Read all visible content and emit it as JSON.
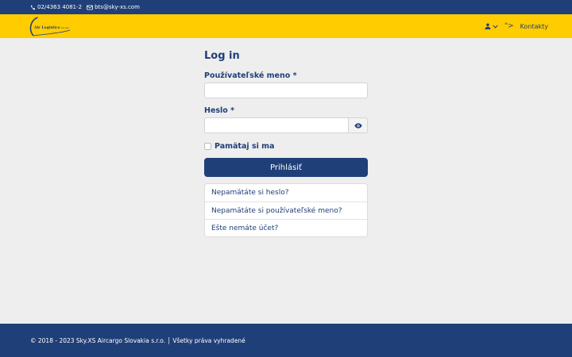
{
  "topbar": {
    "phone": "02/4363 4081-2",
    "email": "bts@sky-xs.com"
  },
  "logo": {
    "name": "Air Logistics",
    "suffix": "Group"
  },
  "nav": {
    "quote": "\">",
    "contacts": "Kontakty"
  },
  "login": {
    "title": "Log in",
    "username_label": "Používateľské meno *",
    "username_value": "",
    "password_label": "Heslo *",
    "password_value": "",
    "remember_label": "Pamätaj si ma",
    "submit_label": "Prihlásiť",
    "links": [
      "Nepamätáte si heslo?",
      "Nepamätáte si používateľské meno?",
      "Ešte nemáte účet?"
    ]
  },
  "footer": {
    "text": "© 2018 - 2023 Sky.XS Aircargo Slovakia s.r.o. │ Všetky práva vyhradené"
  },
  "colors": {
    "primary": "#1f3f78",
    "accent": "#ffcc00",
    "background": "#eeeeee"
  }
}
